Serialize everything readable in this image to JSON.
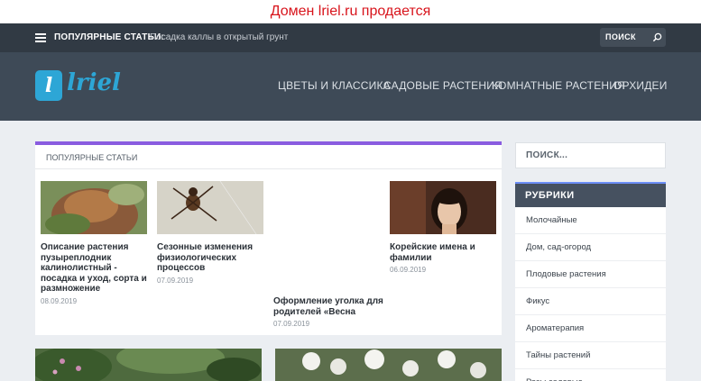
{
  "banner": {
    "text": "Домен lriel.ru продается",
    "color": "#d8141c"
  },
  "topbar": {
    "popular_label": "ПОПУЛЯРНЫЕ СТАТЬИ:",
    "popular_link": "Посадка каллы в открытый грунт",
    "search_label": "ПОИСК"
  },
  "header": {
    "logo_letter": "l",
    "logo_text": "lriel",
    "nav": [
      "ЦВЕТЫ И КЛАССИКА",
      "САДОВЫЕ РАСТЕНИЯ",
      "КОМНАТНЫЕ РАСТЕНИЯ",
      "ОРХИДЕИ"
    ]
  },
  "main": {
    "panel_title": "ПОПУЛЯРНЫЕ СТАТЬИ",
    "articles": [
      {
        "title": "Описание растения пузыреплодник калинолистный - посадка и уход, сорта и размножение",
        "date": "08.09.2019"
      },
      {
        "title": "Сезонные изменения физиологических процессов",
        "date": "07.09.2019"
      },
      {
        "title": "Оформление уголка для родителей «Весна",
        "date": "07.09.2019"
      },
      {
        "title": "Корейские имена и фамилии",
        "date": "06.09.2019"
      }
    ]
  },
  "sidebar": {
    "search_placeholder": "ПОИСК...",
    "rubrics_title": "РУБРИКИ",
    "rubrics": [
      "Молочайные",
      "Дом, сад-огород",
      "Плодовые растения",
      "Фикус",
      "Ароматерапия",
      "Тайны растений",
      "Розы садовые"
    ]
  },
  "colors": {
    "topbar": "#313a44",
    "header": "#3e4a57",
    "accent_purple": "#8a5ce0",
    "logo_blue": "#2da6d6"
  }
}
